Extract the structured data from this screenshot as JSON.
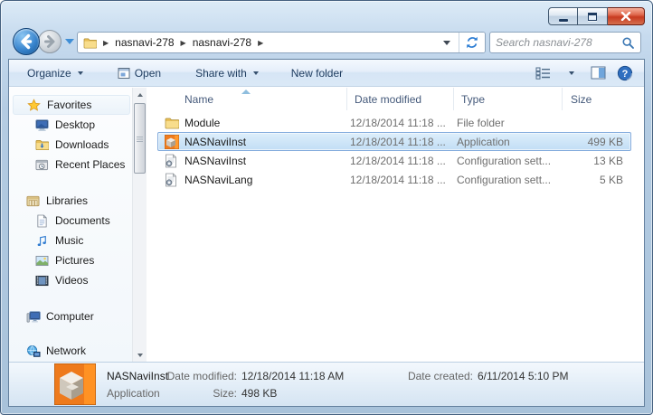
{
  "titlebar": {
    "minimize": "minimize",
    "maximize": "maximize",
    "close": "close"
  },
  "navbar": {
    "breadcrumb_separator": "▶",
    "breadcrumbs": [
      "nasnavi-278",
      "nasnavi-278"
    ],
    "search_placeholder": "Search nasnavi-278"
  },
  "toolbar": {
    "organize_label": "Organize",
    "open_label": "Open",
    "share_with_label": "Share with",
    "new_folder_label": "New folder"
  },
  "sidebar": {
    "favorites_label": "Favorites",
    "desktop_label": "Desktop",
    "downloads_label": "Downloads",
    "recent_places_label": "Recent Places",
    "libraries_label": "Libraries",
    "documents_label": "Documents",
    "music_label": "Music",
    "pictures_label": "Pictures",
    "videos_label": "Videos",
    "computer_label": "Computer",
    "network_label": "Network"
  },
  "filelist": {
    "columns": [
      "Name",
      "Date modified",
      "Type",
      "Size"
    ],
    "rows": [
      {
        "name": "Module",
        "date": "12/18/2014 11:18 ...",
        "type": "File folder",
        "size": "",
        "icon": "folder",
        "selected": false
      },
      {
        "name": "NASNaviInst",
        "date": "12/18/2014 11:18 ...",
        "type": "Application",
        "size": "499 KB",
        "icon": "installer",
        "selected": true
      },
      {
        "name": "NASNaviInst",
        "date": "12/18/2014 11:18 ...",
        "type": "Configuration sett...",
        "size": "13 KB",
        "icon": "config",
        "selected": false
      },
      {
        "name": "NASNaviLang",
        "date": "12/18/2014 11:18 ...",
        "type": "Configuration sett...",
        "size": "5 KB",
        "icon": "config",
        "selected": false
      }
    ]
  },
  "details": {
    "name": "NASNaviInst",
    "type": "Application",
    "date_modified_label": "Date modified:",
    "date_modified": "12/18/2014 11:18 AM",
    "size_label": "Size:",
    "size": "498 KB",
    "date_created_label": "Date created:",
    "date_created": "6/11/2014 5:10 PM"
  },
  "colors": {
    "selection_border": "#84acdd",
    "selection_fill": "#c2def5",
    "close_button": "#c83b20",
    "frame": "#b4cce3",
    "accent_blue": "#2e7cc4"
  }
}
